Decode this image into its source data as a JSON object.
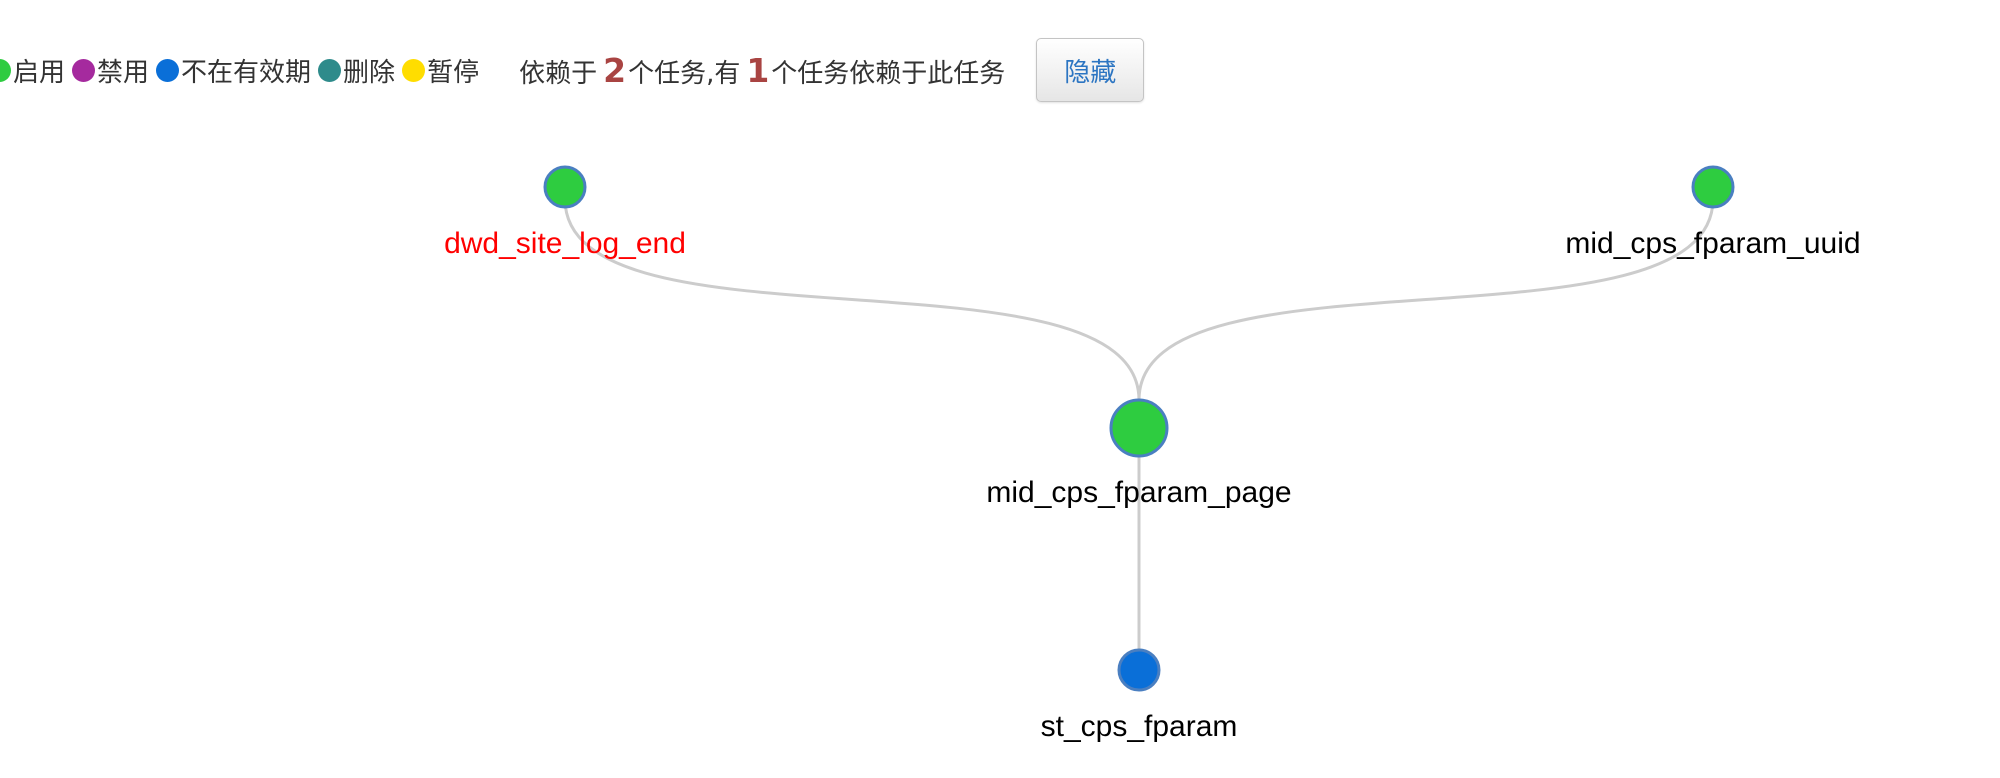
{
  "legend": [
    {
      "label": "启用",
      "color": "#2ecc40"
    },
    {
      "label": "禁用",
      "color": "#a52a9e"
    },
    {
      "label": "不在有效期",
      "color": "#0a6fd8"
    },
    {
      "label": "删除",
      "color": "#2e8b8b"
    },
    {
      "label": "暂停",
      "color": "#ffdd00"
    }
  ],
  "summary": {
    "prefix": "依赖于",
    "upstream_count": "2",
    "middle": "个任务,有",
    "downstream_count": "1",
    "suffix": "个任务依赖于此任务"
  },
  "hide_button_label": "隐藏",
  "graph": {
    "nodes": [
      {
        "id": "dwd_site_log_end",
        "label": "dwd_site_log_end",
        "status_color": "#2ecc40",
        "label_color": "#ff0000",
        "size": "small"
      },
      {
        "id": "mid_cps_fparam_uuid",
        "label": "mid_cps_fparam_uuid",
        "status_color": "#2ecc40",
        "label_color": "#000000",
        "size": "small"
      },
      {
        "id": "mid_cps_fparam_page",
        "label": "mid_cps_fparam_page",
        "status_color": "#2ecc40",
        "label_color": "#000000",
        "size": "large"
      },
      {
        "id": "st_cps_fparam",
        "label": "st_cps_fparam",
        "status_color": "#0a6fd8",
        "label_color": "#000000",
        "size": "small"
      }
    ],
    "edges": [
      {
        "from": "dwd_site_log_end",
        "to": "mid_cps_fparam_page"
      },
      {
        "from": "mid_cps_fparam_uuid",
        "to": "mid_cps_fparam_page"
      },
      {
        "from": "mid_cps_fparam_page",
        "to": "st_cps_fparam"
      }
    ]
  }
}
